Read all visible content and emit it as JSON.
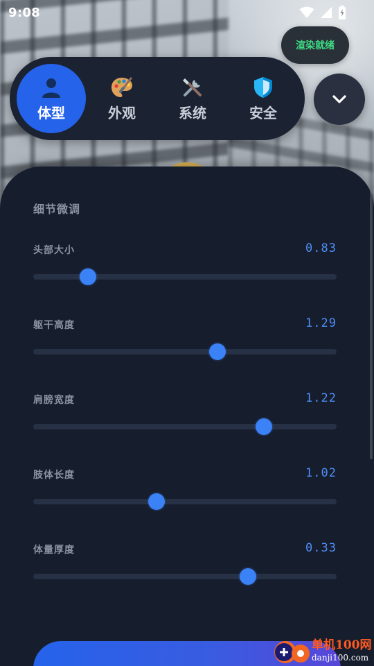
{
  "status_bar": {
    "time": "9:08"
  },
  "render_status": {
    "label": "渲染就绪",
    "color": "#3ddc84"
  },
  "nav": {
    "tabs": [
      {
        "label": "体型",
        "icon": "person-icon",
        "active": true
      },
      {
        "label": "外观",
        "icon": "palette-icon",
        "active": false
      },
      {
        "label": "系统",
        "icon": "tools-icon",
        "active": false
      },
      {
        "label": "安全",
        "icon": "shield-icon",
        "active": false
      }
    ],
    "expand_icon": "chevron-down-icon"
  },
  "panel": {
    "section_title": "细节微调",
    "sliders": [
      {
        "label": "头部大小",
        "value": "0.83",
        "level": 0.18
      },
      {
        "label": "躯干高度",
        "value": "1.29",
        "level": 0.607
      },
      {
        "label": "肩膀宽度",
        "value": "1.22",
        "level": 0.76
      },
      {
        "label": "肢体长度",
        "value": "1.02",
        "level": 0.406
      },
      {
        "label": "体量厚度",
        "value": "0.33",
        "level": 0.708
      }
    ],
    "bottom_button_label": "..."
  },
  "watermark": {
    "title": "单机100网",
    "url": "danji100.com"
  },
  "colors": {
    "accent": "#2563eb",
    "slider_thumb": "#3b82f6",
    "value_text": "#4f8ef7",
    "panel_bg": "#161d2d"
  }
}
